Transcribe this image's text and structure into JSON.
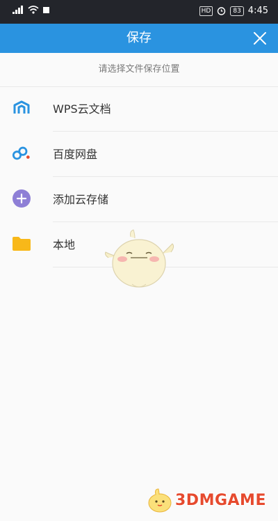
{
  "status_bar": {
    "signal": "4G",
    "hd_badge": "HD",
    "battery": "83",
    "time": "4:45"
  },
  "header": {
    "title": "保存",
    "close_icon": "close-icon"
  },
  "prompt": "请选择文件保存位置",
  "locations": [
    {
      "label": "WPS云文档",
      "icon": "wps-cloud-icon"
    },
    {
      "label": "百度网盘",
      "icon": "baidu-netdisk-icon"
    },
    {
      "label": "添加云存储",
      "icon": "add-cloud-icon"
    },
    {
      "label": "本地",
      "icon": "folder-icon"
    }
  ],
  "watermark": {
    "text": "3DMGAME"
  },
  "colors": {
    "accent": "#2a93e0",
    "status_bar": "#23252b",
    "purple": "#8e7fd6",
    "folder": "#f8b819",
    "watermark": "#e64a2e"
  }
}
